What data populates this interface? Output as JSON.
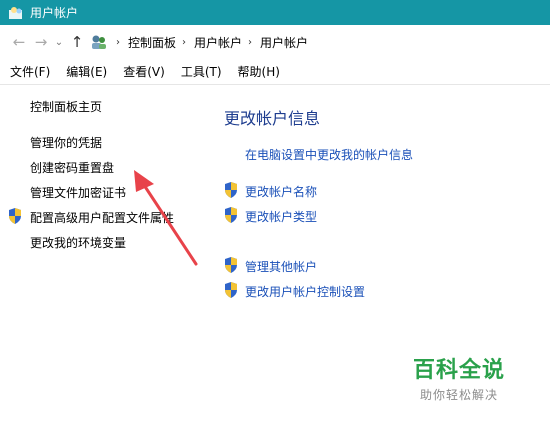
{
  "window": {
    "title": "用户帐户"
  },
  "address_bar": {
    "crumbs": [
      "控制面板",
      "用户帐户",
      "用户帐户"
    ]
  },
  "menu": [
    "文件(F)",
    "编辑(E)",
    "查看(V)",
    "工具(T)",
    "帮助(H)"
  ],
  "left_panel": {
    "home": "控制面板主页",
    "links": [
      "管理你的凭据",
      "创建密码重置盘",
      "管理文件加密证书",
      "配置高级用户配置文件属性",
      "更改我的环境变量"
    ]
  },
  "main": {
    "heading": "更改帐户信息",
    "pc_settings_link": "在电脑设置中更改我的帐户信息",
    "links": [
      "更改帐户名称",
      "更改帐户类型",
      "管理其他帐户",
      "更改用户帐户控制设置"
    ]
  },
  "watermark": {
    "title": "百科全说",
    "subtitle": "助你轻松解决"
  },
  "colors": {
    "titlebar": "#1596a5",
    "link": "#1a50b8",
    "heading": "#1e3d8f",
    "arrow": "#e8434a",
    "watermark": "#2aa14b"
  }
}
